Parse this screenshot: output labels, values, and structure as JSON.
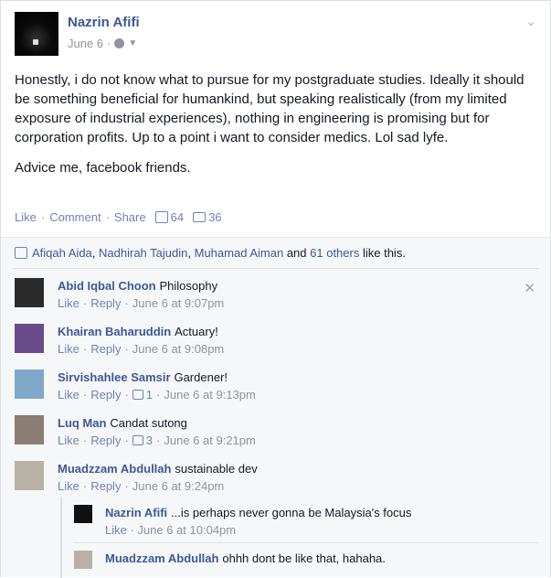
{
  "post": {
    "author": "Nazrin Afifi",
    "date": "June 6",
    "meta_sep": "·",
    "paragraph1": "Honestly, i do not know what to pursue for my postgraduate studies. Ideally it should be something beneficial for humankind, but speaking realistically (from my limited exposure of industrial experiences), nothing in engineering is promising but for corporation profits. Up to a point i want to consider medics. Lol sad lyfe.",
    "paragraph2": "Advice me, facebook friends.",
    "actions": {
      "like": "Like",
      "comment": "Comment",
      "share": "Share",
      "dot": "·",
      "like_count": "64",
      "comment_count": "36"
    }
  },
  "likes": {
    "name1": "Afiqah Aida",
    "name2": "Nadhirah Tajudin",
    "name3": "Muhamad Aiman",
    "and": "and",
    "others": "61 others",
    "suffix": "like this.",
    "comma": ","
  },
  "comments": [
    {
      "name": "Abid Iqbal Choon",
      "text": "Philosophy",
      "like": "Like",
      "reply": "Reply",
      "likes": "",
      "time": "June 6 at 9:07pm",
      "avatar": "#2b2b2b"
    },
    {
      "name": "Khairan Baharuddin",
      "text": "Actuary!",
      "like": "Like",
      "reply": "Reply",
      "likes": "",
      "time": "June 6 at 9:08pm",
      "avatar": "#6a4b8c"
    },
    {
      "name": "Sirvishahlee Samsir",
      "text": "Gardener!",
      "like": "Like",
      "reply": "Reply",
      "likes": "1",
      "time": "June 6 at 9:13pm",
      "avatar": "#7fa8c9"
    },
    {
      "name": "Luq Man",
      "text": "Candat sutong",
      "like": "Like",
      "reply": "Reply",
      "likes": "3",
      "time": "June 6 at 9:21pm",
      "avatar": "#8a7d74"
    },
    {
      "name": "Muadzzam Abdullah",
      "text": "sustainable dev",
      "like": "Like",
      "reply": "Reply",
      "likes": "",
      "time": "June 6 at 9:24pm",
      "avatar": "#b8b2a6"
    }
  ],
  "replies": [
    {
      "name": "Nazrin Afifi",
      "text": "...is perhaps never gonna be Malaysia's focus",
      "like": "Like",
      "time": "June 6 at 10:04pm",
      "avatar": "#111111"
    },
    {
      "name": "Muadzzam Abdullah",
      "text": "ohhh dont be like that, hahaha.",
      "avatar": "#b8b2a6"
    }
  ],
  "icons": {
    "chevron": "chevron-down-icon",
    "close": "close-icon",
    "globe": "globe-icon",
    "like": "like-icon",
    "comment": "comment-icon"
  },
  "colors": {
    "link": "#3b5998",
    "muted_link": "#6d84b4",
    "meta": "#90949c",
    "feedback_bg": "#f6f7f9"
  }
}
